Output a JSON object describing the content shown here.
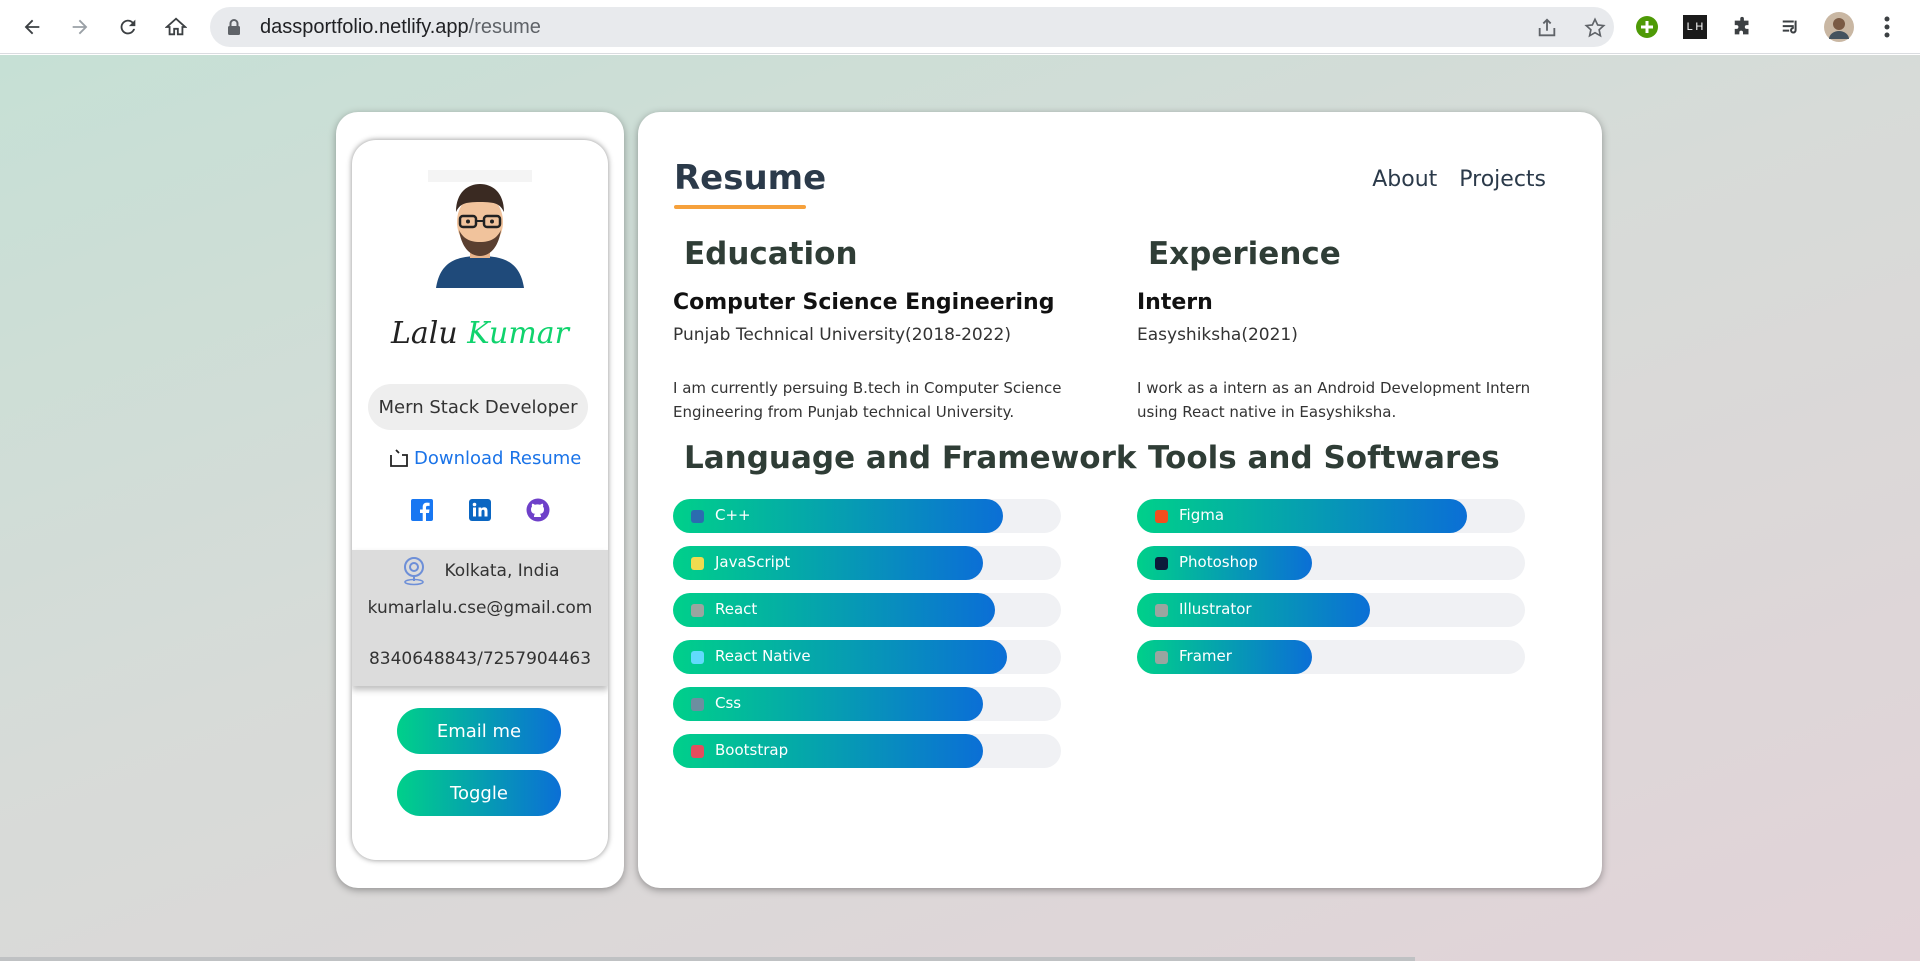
{
  "browser": {
    "url_domain": "dassportfolio.netlify.app",
    "url_path": "/resume",
    "extension_lh_label": "L H"
  },
  "profile": {
    "first_name": "Lalu",
    "last_name": "Kumar",
    "role": "Mern Stack Developer",
    "download_label": "Download Resume",
    "location": "Kolkata, India",
    "email": "kumarlalu.cse@gmail.com",
    "phone": "8340648843/7257904463",
    "email_button": "Email me",
    "toggle_button": "Toggle"
  },
  "main": {
    "title": "Resume",
    "nav": [
      "About",
      "Projects"
    ],
    "education": {
      "heading": "Education",
      "title": "Computer Science Engineering",
      "subtitle": "Punjab Technical University(2018-2022)",
      "description": "I am currently persuing B.tech in Computer Science Engineering from Punjab technical University."
    },
    "experience": {
      "heading": "Experience",
      "title": "Intern",
      "subtitle": "Easyshiksha(2021)",
      "description": "I work as a intern as an Android Development Intern using React native in Easyshiksha."
    },
    "languages": {
      "heading": "Language and Framework",
      "items": [
        {
          "label": "C++",
          "level": 0.85,
          "icon": "cpp-icon",
          "icon_color": "#2b6cb0"
        },
        {
          "label": "JavaScript",
          "level": 0.8,
          "icon": "javascript-icon",
          "icon_color": "#f0db4f"
        },
        {
          "label": "React",
          "level": 0.83,
          "icon": "react-icon",
          "icon_color": "#9aa5a0"
        },
        {
          "label": "React Native",
          "level": 0.86,
          "icon": "react-native-icon",
          "icon_color": "#61dafb"
        },
        {
          "label": "Css",
          "level": 0.8,
          "icon": "css-icon",
          "icon_color": "#6c8ea0"
        },
        {
          "label": "Bootstrap",
          "level": 0.8,
          "icon": "bootstrap-icon",
          "icon_color": "#e44d5e"
        }
      ]
    },
    "tools": {
      "heading": "Tools and Softwares",
      "items": [
        {
          "label": "Figma",
          "level": 0.85,
          "icon": "figma-icon",
          "icon_color": "#f24e1e"
        },
        {
          "label": "Photoshop",
          "level": 0.45,
          "icon": "photoshop-icon",
          "icon_color": "#0c1a3a"
        },
        {
          "label": "Illustrator",
          "level": 0.6,
          "icon": "illustrator-icon",
          "icon_color": "#9aa5a0"
        },
        {
          "label": "Framer",
          "level": 0.45,
          "icon": "framer-icon",
          "icon_color": "#9aa5a0"
        }
      ]
    }
  },
  "colors": {
    "accent_green": "#10d36d",
    "gradient_start": "#00d08a",
    "gradient_end": "#0b6fd6",
    "title_underline": "#f6a13c",
    "link_blue": "#1a73e8"
  }
}
